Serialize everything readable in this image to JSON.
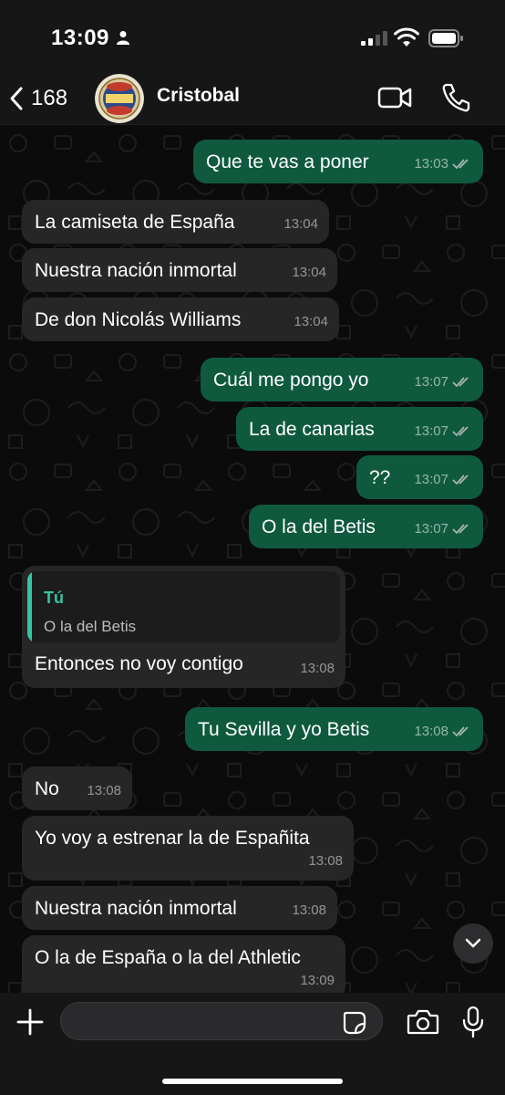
{
  "status_bar": {
    "time": "13:09"
  },
  "header": {
    "back_count": "168",
    "contact_name": "Cristobal"
  },
  "messages": [
    {
      "dir": "out",
      "text": "Que te vas a poner",
      "time": "13:03"
    },
    {
      "dir": "in",
      "text": "La camiseta de España",
      "time": "13:04"
    },
    {
      "dir": "in",
      "text": "Nuestra nación inmortal",
      "time": "13:04"
    },
    {
      "dir": "in",
      "text": "De don Nicolás Williams",
      "time": "13:04"
    },
    {
      "dir": "out",
      "text": "Cuál me pongo yo",
      "time": "13:07"
    },
    {
      "dir": "out",
      "text": "La de canarias",
      "time": "13:07"
    },
    {
      "dir": "out",
      "text": "??",
      "time": "13:07"
    },
    {
      "dir": "out",
      "text": "O la del Betis",
      "time": "13:07"
    },
    {
      "dir": "in",
      "text": "Entonces no voy contigo",
      "time": "13:08",
      "quote": {
        "author": "Tú",
        "text": "O la del Betis"
      }
    },
    {
      "dir": "out",
      "text": "Tu Sevilla y yo Betis",
      "time": "13:08"
    },
    {
      "dir": "in",
      "text": "No",
      "time": "13:08"
    },
    {
      "dir": "in",
      "text": "Yo voy a estrenar la de Españita",
      "time": "13:08"
    },
    {
      "dir": "in",
      "text": "Nuestra nación inmortal",
      "time": "13:08"
    },
    {
      "dir": "in",
      "text": "O la de España o la del Athletic",
      "time": "13:09"
    }
  ],
  "composer": {
    "placeholder": ""
  },
  "colors": {
    "incoming_bubble": "#262627",
    "outgoing_bubble": "#0f5a3e",
    "accent": "#35c5a0",
    "read_ticks": "#a8b5b0"
  }
}
